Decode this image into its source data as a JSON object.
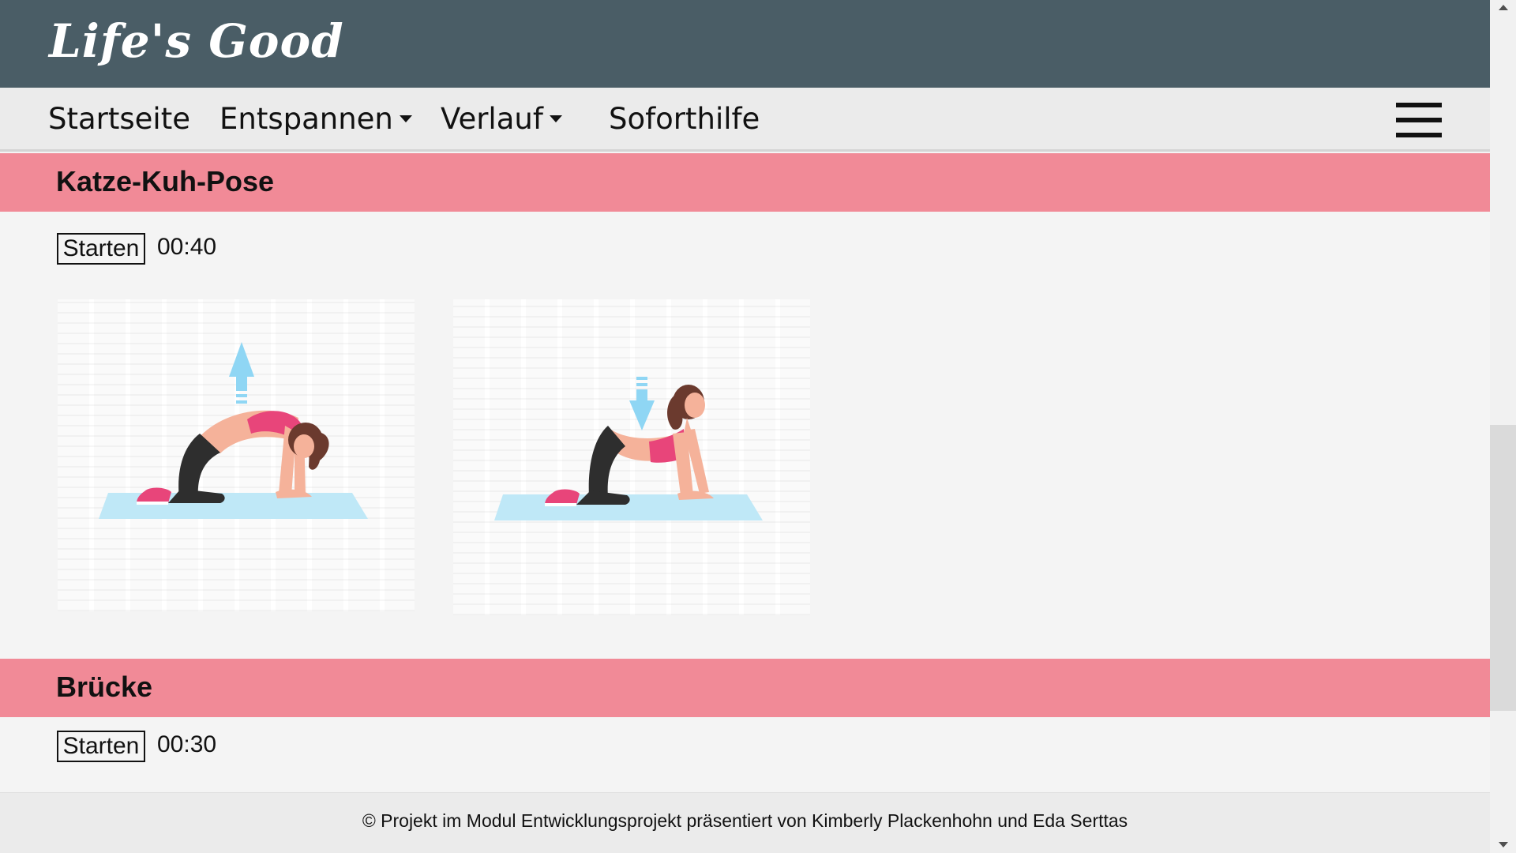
{
  "header": {
    "logo": "Life's Good"
  },
  "nav": {
    "items": [
      {
        "label": "Startseite",
        "dropdown": false
      },
      {
        "label": "Entspannen",
        "dropdown": true
      },
      {
        "label": "Verlauf",
        "dropdown": true
      },
      {
        "label": "Soforthilfe",
        "dropdown": false
      }
    ],
    "menu_icon": "hamburger-menu-icon"
  },
  "exercises": [
    {
      "title": "Katze-Kuh-Pose",
      "button_label": "Starten",
      "timer": "00:40",
      "images": [
        "cat-pose-illustration",
        "cow-pose-illustration"
      ]
    },
    {
      "title": "Brücke",
      "button_label": "Starten",
      "timer": "00:30"
    }
  ],
  "footer": {
    "text": "© Projekt im Modul Entwicklungsprojekt präsentiert von Kimberly Plackenhohn und Eda Serttas"
  },
  "colors": {
    "header_bg": "#4a5d66",
    "nav_bg": "#ebebeb",
    "section_bar": "#f18a97",
    "page_bg": "#f4f4f4",
    "mat": "#bfe8f7",
    "arrow": "#8fd6f4",
    "top_pink": "#e8457a",
    "skin": "#f5b29a",
    "hair": "#6b3a2e",
    "pants": "#2e2e2e"
  }
}
